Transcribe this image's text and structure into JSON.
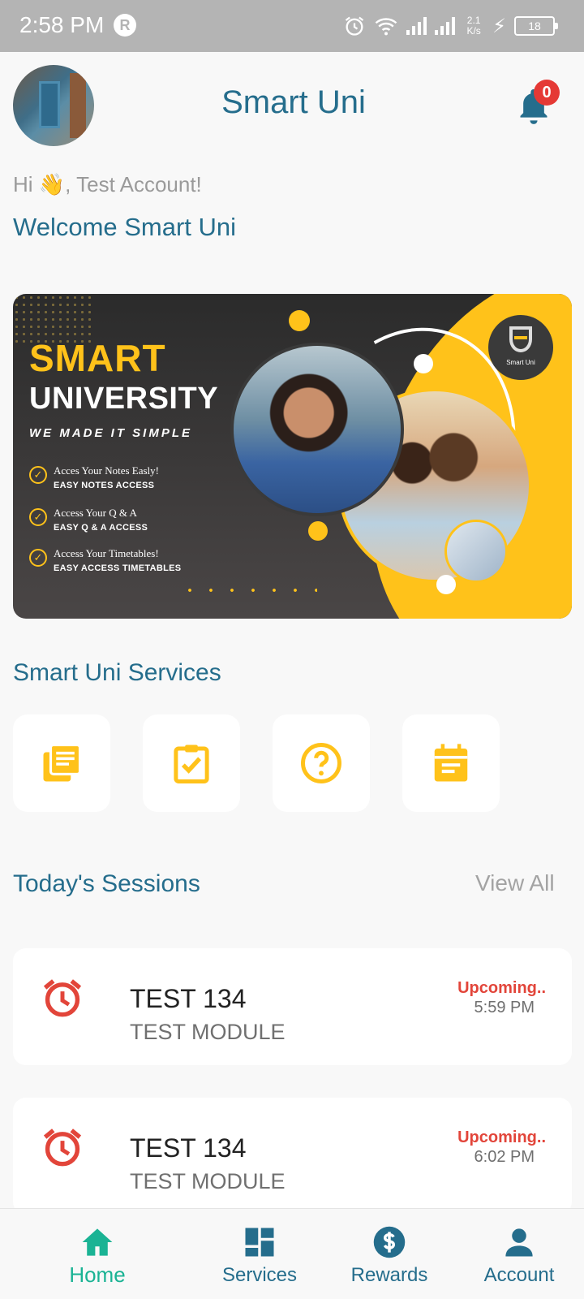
{
  "status_bar": {
    "time": "2:58 PM",
    "network_speed_value": "2.1",
    "network_speed_unit": "K/s",
    "battery": "18",
    "icons": [
      "alarm-icon",
      "wifi-icon",
      "signal-icon",
      "charging-icon",
      "battery-icon"
    ]
  },
  "header": {
    "title": "Smart Uni",
    "notification_count": "0"
  },
  "greeting": {
    "hi": "Hi 👋, Test Account!",
    "welcome": "Welcome Smart Uni"
  },
  "banner": {
    "headline_1": "SMART",
    "headline_2": "UNIVERSITY",
    "tagline": "WE MADE IT SIMPLE",
    "logo_text": "Smart Uni",
    "features": [
      {
        "line1": "Acces Your Notes Easly!",
        "line2": "EASY NOTES ACCESS"
      },
      {
        "line1": "Access Your  Q & A",
        "line2": "EASY Q & A ACCESS"
      },
      {
        "line1": "Access Your Timetables!",
        "line2": "EASY ACCESS TIMETABLES"
      }
    ]
  },
  "services": {
    "title": "Smart Uni Services",
    "items": [
      {
        "icon": "notes-icon"
      },
      {
        "icon": "tasks-icon"
      },
      {
        "icon": "question-icon"
      },
      {
        "icon": "timetable-icon"
      }
    ]
  },
  "sessions": {
    "title": "Today's Sessions",
    "view_all": "View All",
    "items": [
      {
        "title": "TEST 134",
        "module": "TEST MODULE",
        "status": "Upcoming..",
        "time": "5:59 PM"
      },
      {
        "title": "TEST 134",
        "module": "TEST MODULE",
        "status": "Upcoming..",
        "time": "6:02 PM"
      }
    ]
  },
  "bottom_nav": {
    "items": [
      {
        "label": "Home",
        "icon": "home-icon",
        "active": true
      },
      {
        "label": "Services",
        "icon": "services-icon",
        "active": false
      },
      {
        "label": "Rewards",
        "icon": "dollar-icon",
        "active": false
      },
      {
        "label": "Account",
        "icon": "account-icon",
        "active": false
      }
    ]
  },
  "colors": {
    "primary": "#256d8c",
    "accent_yellow": "#ffc21a",
    "active_green": "#1ab394",
    "alert_red": "#e2453a"
  }
}
